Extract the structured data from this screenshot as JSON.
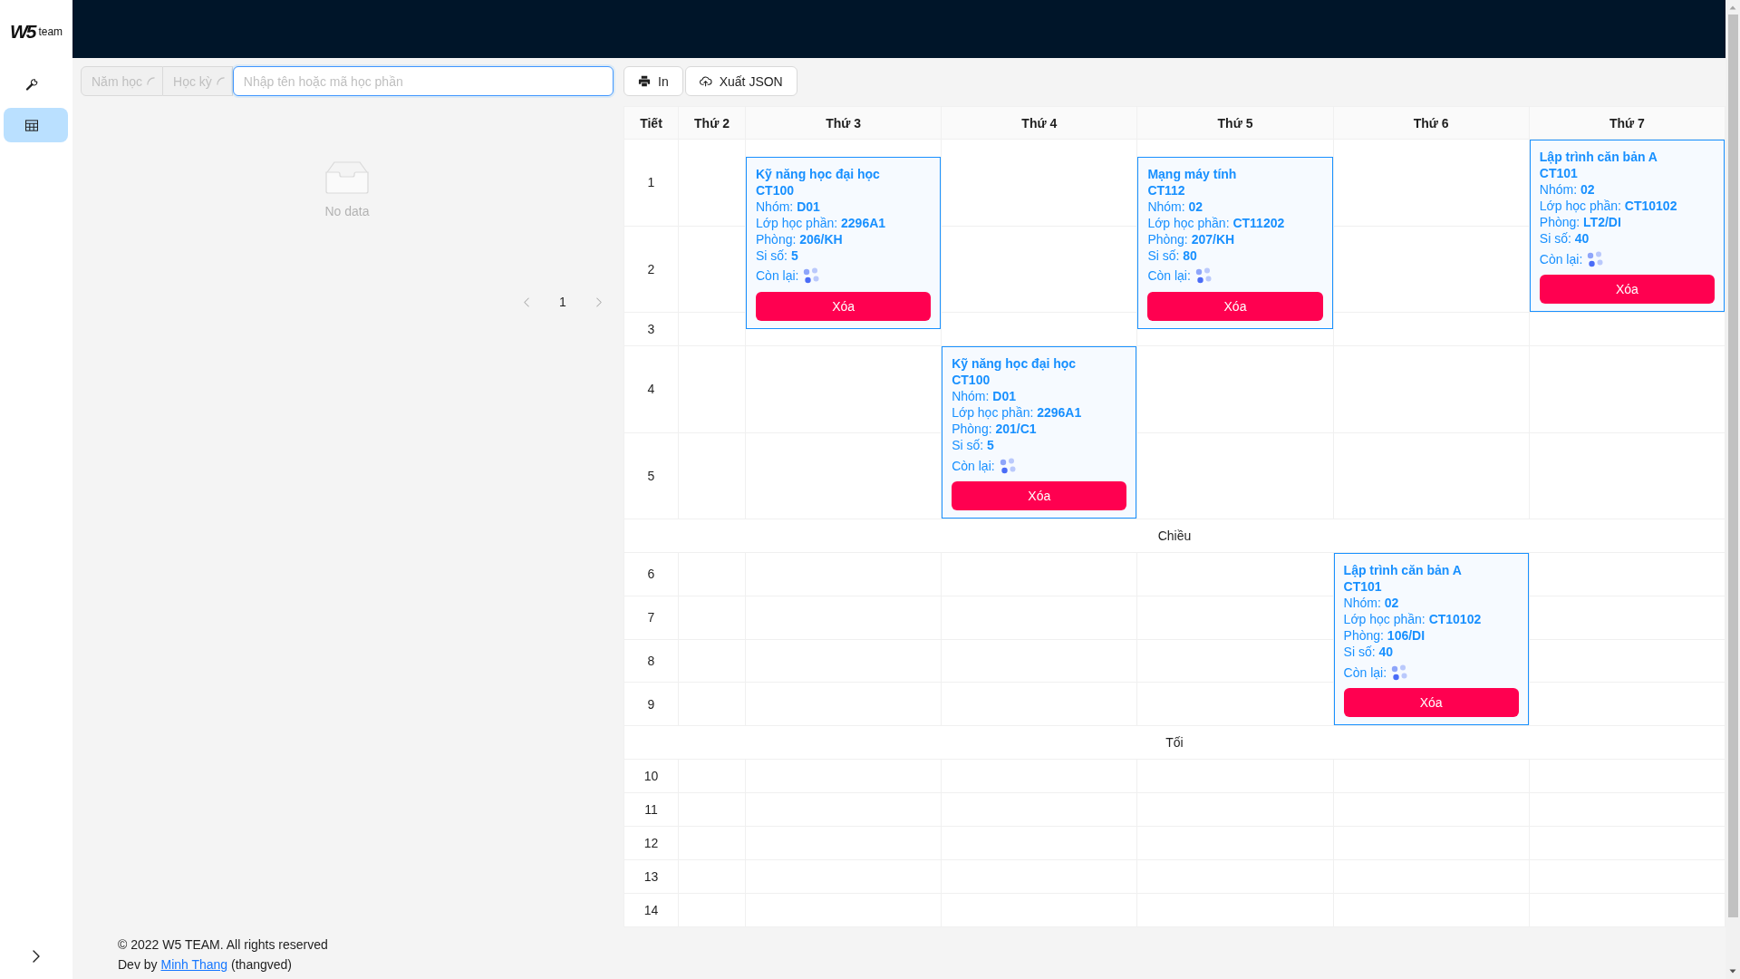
{
  "sidebar": {
    "logo": {
      "mark": "W5",
      "text": "team"
    },
    "items": [
      {
        "kind": "tools",
        "selected": false
      },
      {
        "kind": "timetable",
        "selected": true
      }
    ]
  },
  "filters": {
    "selects": [
      {
        "placeholder": "Năm học",
        "disabled": true,
        "loading": true
      },
      {
        "placeholder": "Học kỳ",
        "disabled": true,
        "loading": true
      }
    ],
    "search": {
      "placeholder": "Nhập tên hoặc mã học phần",
      "focused": true
    }
  },
  "actions": [
    {
      "kind": "print",
      "label": "In"
    },
    {
      "kind": "export",
      "label": "Xuất JSON"
    }
  ],
  "course_list": {
    "empty_text": "No data",
    "pagination": {
      "prev_disabled": true,
      "next_disabled": true,
      "pages": [
        {
          "label": "1",
          "selected": true
        }
      ]
    }
  },
  "timetable": {
    "columns": [
      "Tiết",
      "Thứ 2",
      "Thứ 3",
      "Thứ 4",
      "Thứ 5",
      "Thứ 6",
      "Thứ 7"
    ],
    "sections": [
      {
        "periods": [
          {
            "label": "1",
            "cells": [
              {
                "kind": "empty"
              },
              {
                "kind": "class",
                "title": "Kỹ năng học đại học",
                "code": "CT100",
                "details": [
                  "Nhóm: **D01**",
                  "Lớp học phần: **2296A1**",
                  "Phòng: **206/KH**",
                  "Si số: **5**"
                ],
                "remaining": {
                  "label": "Còn lại:",
                  "loading": true
                },
                "action": "Xóa"
              },
              {
                "kind": "empty"
              },
              {
                "kind": "class",
                "title": "Mạng máy tính",
                "code": "CT112",
                "details": [
                  "Nhóm: **02**",
                  "Lớp học phần: **CT11202**",
                  "Phòng: **207/KH**",
                  "Si số: **80**"
                ],
                "remaining": {
                  "label": "Còn lại:",
                  "loading": true
                },
                "action": "Xóa"
              },
              {
                "kind": "empty"
              },
              {
                "kind": "class",
                "title": "Lập trình căn bản A",
                "code": "CT101",
                "details": [
                  "Nhóm: **02**",
                  "Lớp học phần: **CT10102**",
                  "Phòng: **LT2/DI**",
                  "Si số: **40**"
                ],
                "remaining": {
                  "label": "Còn lại:",
                  "loading": true
                },
                "action": "Xóa"
              }
            ]
          },
          {
            "label": "2",
            "cells": [
              {
                "kind": "empty"
              },
              {
                "kind": "continued"
              },
              {
                "kind": "empty"
              },
              {
                "kind": "continued"
              },
              {
                "kind": "empty"
              },
              {
                "kind": "continued"
              }
            ]
          },
          {
            "label": "3",
            "cells": [
              {
                "kind": "empty"
              },
              {
                "kind": "continued"
              },
              {
                "kind": "empty"
              },
              {
                "kind": "continued"
              },
              {
                "kind": "empty"
              },
              {
                "kind": "empty"
              }
            ]
          },
          {
            "label": "4",
            "cells": [
              {
                "kind": "empty"
              },
              {
                "kind": "empty"
              },
              {
                "kind": "class",
                "title": "Kỹ năng học đại học",
                "code": "CT100",
                "details": [
                  "Nhóm: **D01**",
                  "Lớp học phần: **2296A1**",
                  "Phòng: **201/C1**",
                  "Si số: **5**"
                ],
                "remaining": {
                  "label": "Còn lại:",
                  "loading": true
                },
                "action": "Xóa"
              },
              {
                "kind": "empty"
              },
              {
                "kind": "empty"
              },
              {
                "kind": "empty"
              }
            ]
          },
          {
            "label": "5",
            "cells": [
              {
                "kind": "empty"
              },
              {
                "kind": "empty"
              },
              {
                "kind": "continued"
              },
              {
                "kind": "empty"
              },
              {
                "kind": "empty"
              },
              {
                "kind": "empty"
              }
            ]
          }
        ]
      },
      {
        "label": "Chiều",
        "periods": [
          {
            "label": "6",
            "cells": [
              {
                "kind": "empty"
              },
              {
                "kind": "empty"
              },
              {
                "kind": "empty"
              },
              {
                "kind": "empty"
              },
              {
                "kind": "class",
                "title": "Lập trình căn bản A",
                "code": "CT101",
                "details": [
                  "Nhóm: **02**",
                  "Lớp học phần: **CT10102**",
                  "Phòng: **106/DI**",
                  "Si số: **40**"
                ],
                "remaining": {
                  "label": "Còn lại:",
                  "loading": true
                },
                "action": "Xóa"
              },
              {
                "kind": "empty"
              }
            ]
          },
          {
            "label": "7",
            "cells": [
              {
                "kind": "empty"
              },
              {
                "kind": "empty"
              },
              {
                "kind": "empty"
              },
              {
                "kind": "empty"
              },
              {
                "kind": "continued"
              },
              {
                "kind": "empty"
              }
            ]
          },
          {
            "label": "8",
            "cells": [
              {
                "kind": "empty"
              },
              {
                "kind": "empty"
              },
              {
                "kind": "empty"
              },
              {
                "kind": "empty"
              },
              {
                "kind": "continued"
              },
              {
                "kind": "empty"
              }
            ]
          },
          {
            "label": "9",
            "cells": [
              {
                "kind": "empty"
              },
              {
                "kind": "empty"
              },
              {
                "kind": "empty"
              },
              {
                "kind": "empty"
              },
              {
                "kind": "continued"
              },
              {
                "kind": "empty"
              }
            ]
          }
        ]
      },
      {
        "label": "Tối",
        "periods": [
          {
            "label": "10",
            "cells": [
              {
                "kind": "empty"
              },
              {
                "kind": "empty"
              },
              {
                "kind": "empty"
              },
              {
                "kind": "empty"
              },
              {
                "kind": "empty"
              },
              {
                "kind": "empty"
              }
            ]
          },
          {
            "label": "11",
            "cells": [
              {
                "kind": "empty"
              },
              {
                "kind": "empty"
              },
              {
                "kind": "empty"
              },
              {
                "kind": "empty"
              },
              {
                "kind": "empty"
              },
              {
                "kind": "empty"
              }
            ]
          },
          {
            "label": "12",
            "cells": [
              {
                "kind": "empty"
              },
              {
                "kind": "empty"
              },
              {
                "kind": "empty"
              },
              {
                "kind": "empty"
              },
              {
                "kind": "empty"
              },
              {
                "kind": "empty"
              }
            ]
          },
          {
            "label": "13",
            "cells": [
              {
                "kind": "empty"
              },
              {
                "kind": "empty"
              },
              {
                "kind": "empty"
              },
              {
                "kind": "empty"
              },
              {
                "kind": "empty"
              },
              {
                "kind": "empty"
              }
            ]
          },
          {
            "label": "14",
            "cells": [
              {
                "kind": "empty"
              },
              {
                "kind": "empty"
              },
              {
                "kind": "empty"
              },
              {
                "kind": "empty"
              },
              {
                "kind": "empty"
              },
              {
                "kind": "empty"
              }
            ]
          }
        ]
      }
    ]
  },
  "footer": {
    "copyright": "© 2022 W5 TEAM. All rights reserved",
    "credit": {
      "before": "Dev by",
      "link": "Minh Thang",
      "after": "(thangved)"
    }
  }
}
